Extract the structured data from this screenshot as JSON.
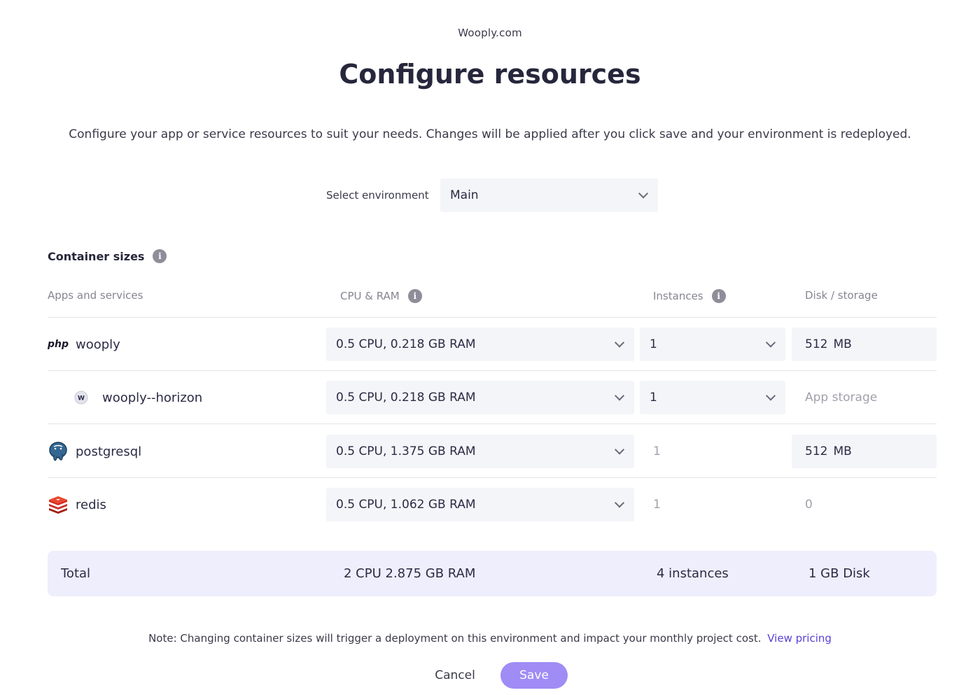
{
  "header": {
    "project_name": "Wooply.com",
    "title": "Configure resources",
    "description": "Configure your app or service resources to suit your needs. Changes will be applied after you click save and your environment is redeployed."
  },
  "environment": {
    "label": "Select environment",
    "selected": "Main"
  },
  "section": {
    "title": "Container sizes"
  },
  "columns": {
    "apps": "Apps and services",
    "cpu": "CPU & RAM",
    "instances": "Instances",
    "disk": "Disk / storage"
  },
  "rows": [
    {
      "name": "wooply",
      "icon": "php-icon",
      "cpu": "0.5 CPU, 0.218 GB RAM",
      "instances": "1",
      "disk_value": "512",
      "disk_unit": "MB"
    },
    {
      "name": "wooply--horizon",
      "icon": "worker-icon",
      "icon_letter": "W",
      "cpu": "0.5 CPU, 0.218 GB RAM",
      "instances": "1",
      "disk_text": "App storage"
    },
    {
      "name": "postgresql",
      "icon": "postgresql-icon",
      "cpu": "0.5 CPU, 1.375 GB RAM",
      "instances": "1",
      "disk_value": "512",
      "disk_unit": "MB"
    },
    {
      "name": "redis",
      "icon": "redis-icon",
      "cpu": "0.5 CPU, 1.062 GB RAM",
      "instances": "1",
      "disk_text": "0"
    }
  ],
  "php_logo_text": "php",
  "info_glyph": "i",
  "total": {
    "label": "Total",
    "cpu": "2 CPU 2.875 GB RAM",
    "instances": "4 instances",
    "disk": "1 GB Disk"
  },
  "footer": {
    "note": "Note: Changing container sizes will trigger a deployment on this environment and impact your monthly project cost.",
    "link": "View pricing",
    "cancel": "Cancel",
    "save": "Save"
  },
  "colors": {
    "accent": "#a08cf5",
    "link": "#5a3fd6",
    "total_bg": "#efeefc",
    "select_bg": "#f4f5f8"
  }
}
